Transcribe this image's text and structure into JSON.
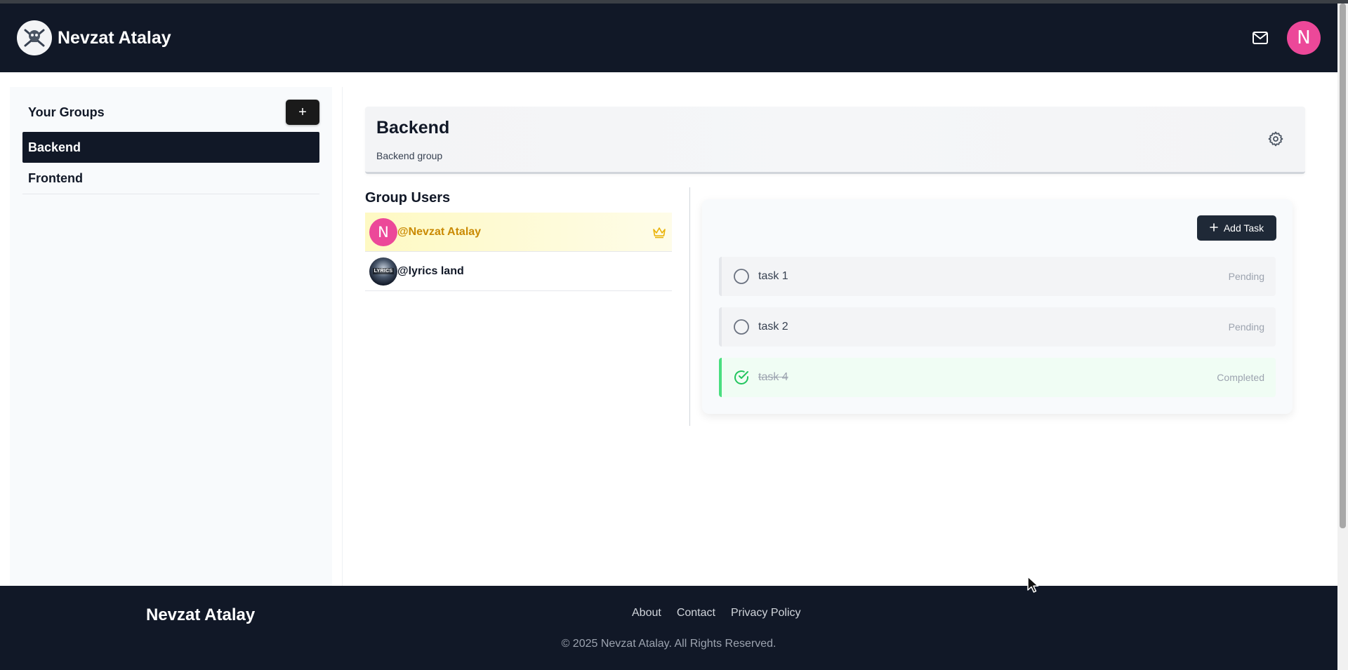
{
  "navbar": {
    "brand_name": "Nevzat Atalay",
    "avatar_initial": "N",
    "mail_icon": "mail-icon",
    "colors": {
      "background": "#111827",
      "avatar": "#ec4899"
    }
  },
  "sidebar": {
    "title": "Your Groups",
    "add_label": "+",
    "groups": [
      {
        "label": "Backend",
        "active": true
      },
      {
        "label": "Frontend",
        "active": false
      }
    ]
  },
  "group": {
    "name": "Backend",
    "description": "Backend group",
    "settings_icon": "gear-icon"
  },
  "users": {
    "title": "Group Users",
    "list": [
      {
        "initial": "N",
        "name": "@Nevzat Atalay",
        "owner": true,
        "badge_icon": "crown-icon"
      },
      {
        "avatar_text": "LYRICS",
        "name": "@lyrics land",
        "owner": false
      }
    ]
  },
  "tasks": {
    "add_label": "Add Task",
    "items": [
      {
        "label": "task 1",
        "status": "Pending",
        "done": false
      },
      {
        "label": "task 2",
        "status": "Pending",
        "done": false
      },
      {
        "label": "task 4",
        "status": "Completed",
        "done": true
      }
    ],
    "colors": {
      "completed": "#22c55e",
      "pending_circle": "#6b7280"
    }
  },
  "footer": {
    "brand": "Nevzat Atalay",
    "links": [
      "About",
      "Contact",
      "Privacy Policy"
    ],
    "copyright": "© 2025 Nevzat Atalay. All Rights Reserved."
  }
}
